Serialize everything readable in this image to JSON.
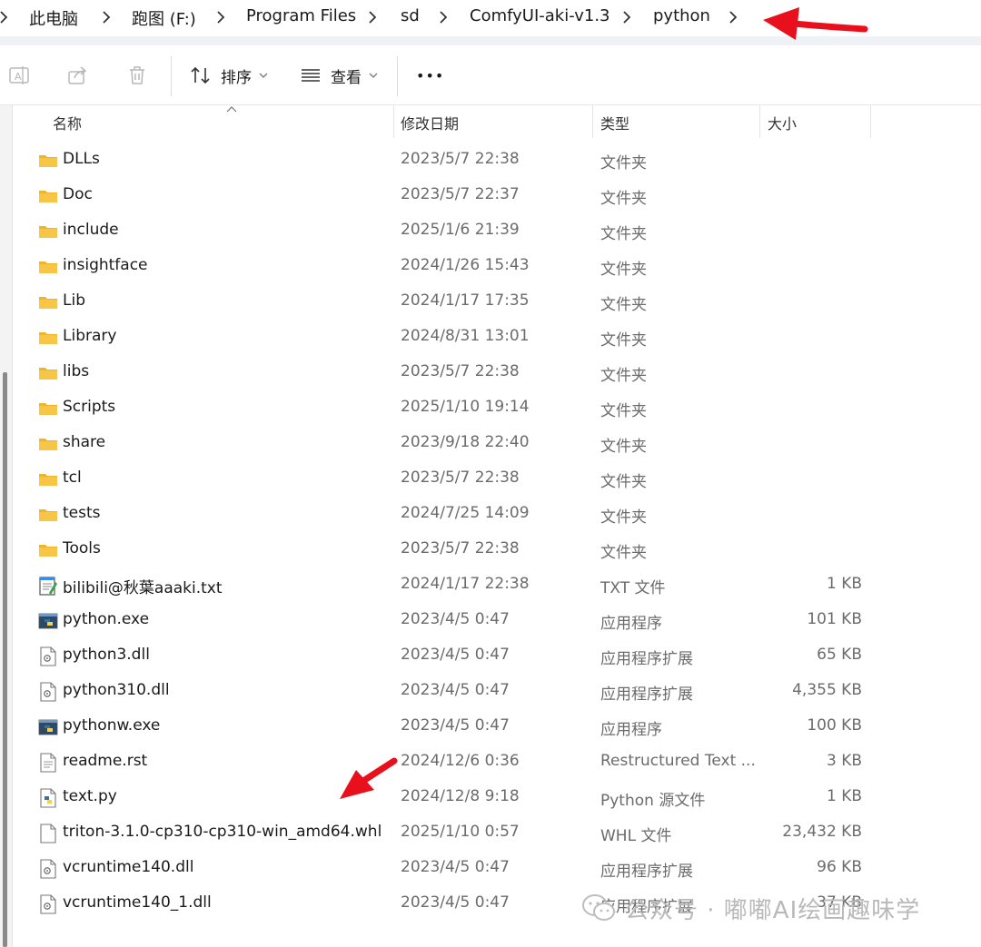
{
  "breadcrumb": [
    "此电脑",
    "跑图 (F:)",
    "Program Files",
    "sd",
    "ComfyUI-aki-v1.3",
    "python"
  ],
  "toolbar": {
    "sort_label": "排序",
    "view_label": "查看",
    "more_label": "•••"
  },
  "columns": {
    "name": "名称",
    "date": "修改日期",
    "type": "类型",
    "size": "大小"
  },
  "files": [
    {
      "name": "DLLs",
      "date": "2023/5/7 22:38",
      "type": "文件夹",
      "size": "",
      "icon": "folder-icon"
    },
    {
      "name": "Doc",
      "date": "2023/5/7 22:37",
      "type": "文件夹",
      "size": "",
      "icon": "folder-icon"
    },
    {
      "name": "include",
      "date": "2025/1/6 21:39",
      "type": "文件夹",
      "size": "",
      "icon": "folder-icon"
    },
    {
      "name": "insightface",
      "date": "2024/1/26 15:43",
      "type": "文件夹",
      "size": "",
      "icon": "folder-icon"
    },
    {
      "name": "Lib",
      "date": "2024/1/17 17:35",
      "type": "文件夹",
      "size": "",
      "icon": "folder-icon"
    },
    {
      "name": "Library",
      "date": "2024/8/31 13:01",
      "type": "文件夹",
      "size": "",
      "icon": "folder-icon"
    },
    {
      "name": "libs",
      "date": "2023/5/7 22:38",
      "type": "文件夹",
      "size": "",
      "icon": "folder-icon"
    },
    {
      "name": "Scripts",
      "date": "2025/1/10 19:14",
      "type": "文件夹",
      "size": "",
      "icon": "folder-icon"
    },
    {
      "name": "share",
      "date": "2023/9/18 22:40",
      "type": "文件夹",
      "size": "",
      "icon": "folder-icon"
    },
    {
      "name": "tcl",
      "date": "2023/5/7 22:38",
      "type": "文件夹",
      "size": "",
      "icon": "folder-icon"
    },
    {
      "name": "tests",
      "date": "2024/7/25 14:09",
      "type": "文件夹",
      "size": "",
      "icon": "folder-icon"
    },
    {
      "name": "Tools",
      "date": "2023/5/7 22:38",
      "type": "文件夹",
      "size": "",
      "icon": "folder-icon"
    },
    {
      "name": "bilibili@秋葉aaaki.txt",
      "date": "2024/1/17 22:38",
      "type": "TXT 文件",
      "size": "1 KB",
      "icon": "text-file-icon"
    },
    {
      "name": "python.exe",
      "date": "2023/4/5 0:47",
      "type": "应用程序",
      "size": "101 KB",
      "icon": "python-exe-icon"
    },
    {
      "name": "python3.dll",
      "date": "2023/4/5 0:47",
      "type": "应用程序扩展",
      "size": "65 KB",
      "icon": "dll-file-icon"
    },
    {
      "name": "python310.dll",
      "date": "2023/4/5 0:47",
      "type": "应用程序扩展",
      "size": "4,355 KB",
      "icon": "dll-file-icon"
    },
    {
      "name": "pythonw.exe",
      "date": "2023/4/5 0:47",
      "type": "应用程序",
      "size": "100 KB",
      "icon": "python-exe-icon"
    },
    {
      "name": "readme.rst",
      "date": "2024/12/6 0:36",
      "type": "Restructured Text ...",
      "size": "3 KB",
      "icon": "document-icon"
    },
    {
      "name": "text.py",
      "date": "2024/12/8 9:18",
      "type": "Python 源文件",
      "size": "1 KB",
      "icon": "python-file-icon"
    },
    {
      "name": "triton-3.1.0-cp310-cp310-win_amd64.whl",
      "date": "2025/1/10 0:57",
      "type": "WHL 文件",
      "size": "23,432 KB",
      "icon": "blank-file-icon"
    },
    {
      "name": "vcruntime140.dll",
      "date": "2023/4/5 0:47",
      "type": "应用程序扩展",
      "size": "96 KB",
      "icon": "dll-file-icon"
    },
    {
      "name": "vcruntime140_1.dll",
      "date": "2023/4/5 0:47",
      "type": "应用程序扩展",
      "size": "37 KB",
      "icon": "dll-file-icon"
    }
  ],
  "watermark": {
    "text": "公众号 · 嘟嘟AI绘画趣味学"
  },
  "colors": {
    "folder": "#f7c646",
    "annotation_arrow": "#e8101c",
    "python_blue": "#3572a5",
    "python_yellow": "#f5d24a"
  }
}
